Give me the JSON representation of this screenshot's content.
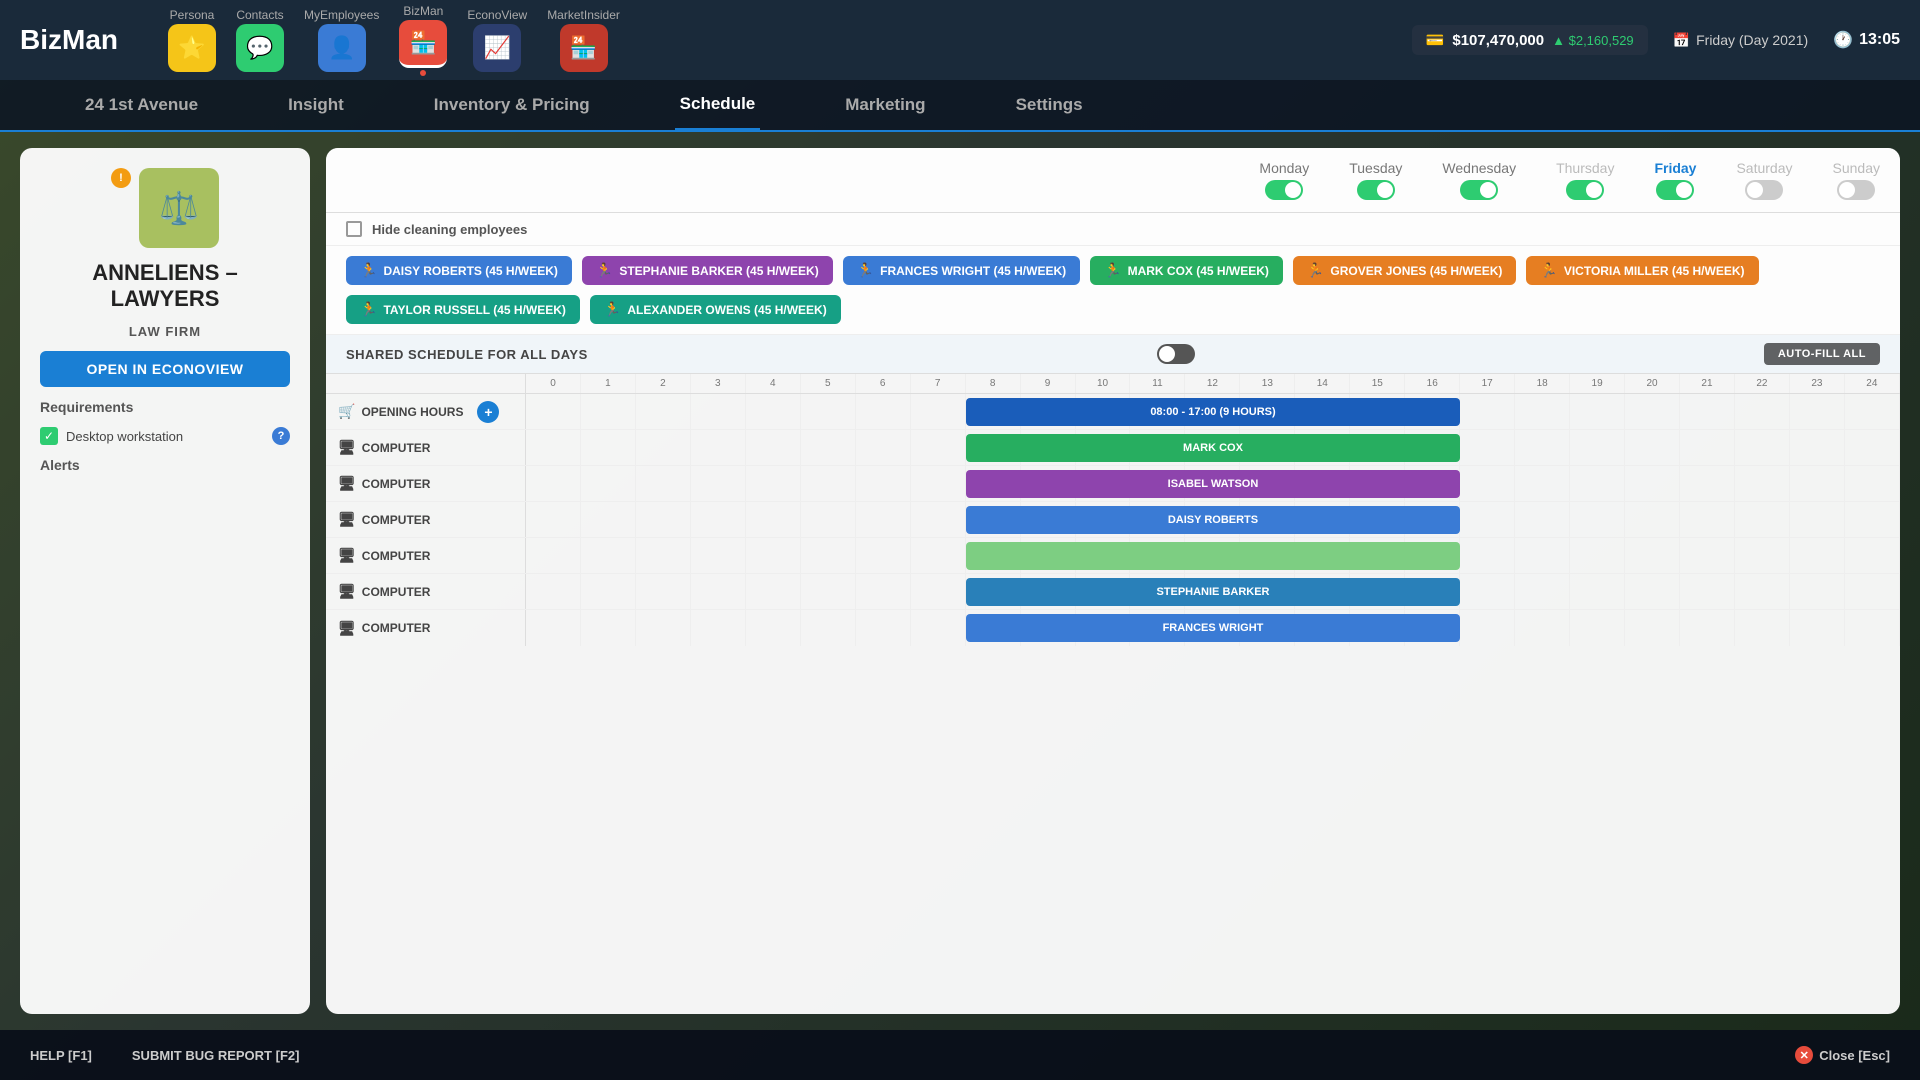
{
  "app": {
    "logo": "BizMan"
  },
  "topbar": {
    "nav_items": [
      {
        "id": "persona",
        "label": "Persona",
        "icon": "⭐",
        "color": "yellow"
      },
      {
        "id": "contacts",
        "label": "Contacts",
        "icon": "💬",
        "color": "green"
      },
      {
        "id": "myemployees",
        "label": "MyEmployees",
        "icon": "👤",
        "color": "blue-mid"
      },
      {
        "id": "bizman",
        "label": "BizMan",
        "icon": "🏪",
        "color": "red",
        "active": true
      },
      {
        "id": "econoview",
        "label": "EconoView",
        "icon": "📈",
        "color": "dark-blue"
      },
      {
        "id": "marketinsider",
        "label": "MarketInsider",
        "icon": "🏪",
        "color": "red2"
      }
    ],
    "money": "$107,470,000",
    "money_gain": "▲ $2,160,529",
    "date": "Friday (Day 2021)",
    "time": "13:05"
  },
  "secondary_nav": {
    "items": [
      {
        "label": "24 1st Avenue",
        "active": false
      },
      {
        "label": "Insight",
        "active": false
      },
      {
        "label": "Inventory & Pricing",
        "active": false
      },
      {
        "label": "Schedule",
        "active": true
      },
      {
        "label": "Marketing",
        "active": false
      },
      {
        "label": "Settings",
        "active": false
      }
    ]
  },
  "left_panel": {
    "company_logo_emoji": "⚖",
    "company_name": "ANNELIENS – LAWYERS",
    "company_type": "LAW FIRM",
    "open_btn_label": "OPEN IN ECONOVIEW",
    "requirements_label": "Requirements",
    "requirement": "Desktop workstation",
    "alerts_label": "Alerts"
  },
  "schedule": {
    "days": [
      {
        "name": "Monday",
        "toggle": "on",
        "active": false
      },
      {
        "name": "Tuesday",
        "toggle": "on",
        "active": false
      },
      {
        "name": "Wednesday",
        "toggle": "on",
        "active": false
      },
      {
        "name": "Thursday",
        "toggle": "on",
        "active": false
      },
      {
        "name": "Friday",
        "toggle": "on",
        "active": true
      },
      {
        "name": "Saturday",
        "toggle": "off",
        "active": false
      },
      {
        "name": "Sunday",
        "toggle": "off",
        "active": false
      }
    ],
    "hide_cleaning_label": "Hide cleaning employees",
    "shared_schedule_label": "SHARED SCHEDULE FOR ALL DAYS",
    "auto_fill_label": "AUTO-FILL ALL",
    "employee_tags": [
      {
        "name": "DAISY ROBERTS (45 H/WEEK)",
        "color": "blue"
      },
      {
        "name": "STEPHANIE BARKER (45 H/WEEK)",
        "color": "purple"
      },
      {
        "name": "FRANCES WRIGHT (45 H/WEEK)",
        "color": "blue"
      },
      {
        "name": "MARK COX (45 H/WEEK)",
        "color": "green"
      },
      {
        "name": "GROVER JONES (45 H/WEEK)",
        "color": "orange"
      },
      {
        "name": "VICTORIA MILLER (45 H/WEEK)",
        "color": "orange"
      },
      {
        "name": "TAYLOR RUSSELL (45 H/WEEK)",
        "color": "teal"
      },
      {
        "name": "ALEXANDER OWENS (45 H/WEEK)",
        "color": "teal"
      }
    ],
    "hours": [
      "0",
      "1",
      "2",
      "3",
      "4",
      "5",
      "6",
      "7",
      "8",
      "9",
      "10",
      "11",
      "12",
      "13",
      "14",
      "15",
      "16",
      "17",
      "18",
      "19",
      "20",
      "21",
      "22",
      "23",
      "24"
    ],
    "rows": [
      {
        "label": "OPENING HOURS",
        "icon": "🛒",
        "type": "opening",
        "block": {
          "label": "08:00 - 17:00 (9 HOURS)",
          "color": "opening",
          "start": 8,
          "end": 17
        }
      },
      {
        "label": "COMPUTER",
        "icon": "🖥",
        "type": "computer",
        "block": {
          "label": "MARK COX",
          "color": "green-block",
          "start": 8,
          "end": 17
        }
      },
      {
        "label": "COMPUTER",
        "icon": "🖥",
        "type": "computer",
        "block": {
          "label": "ISABEL WATSON",
          "color": "purple-block",
          "start": 8,
          "end": 17
        }
      },
      {
        "label": "COMPUTER",
        "icon": "🖥",
        "type": "computer",
        "block": {
          "label": "DAISY ROBERTS",
          "color": "blue-block",
          "start": 8,
          "end": 17
        }
      },
      {
        "label": "COMPUTER",
        "icon": "🖥",
        "type": "computer",
        "block": {
          "label": "",
          "color": "green-light",
          "start": 8,
          "end": 17
        }
      },
      {
        "label": "COMPUTER",
        "icon": "🖥",
        "type": "computer",
        "block": {
          "label": "STEPHANIE BARKER",
          "color": "blue-medium",
          "start": 8,
          "end": 17
        }
      },
      {
        "label": "COMPUTER",
        "icon": "🖥",
        "type": "computer",
        "block": {
          "label": "FRANCES WRIGHT",
          "color": "blue-block",
          "start": 8,
          "end": 17
        }
      }
    ]
  },
  "bottom_bar": {
    "help": "HELP [F1]",
    "bug_report": "SUBMIT BUG REPORT [F2]",
    "close": "Close [Esc]"
  }
}
